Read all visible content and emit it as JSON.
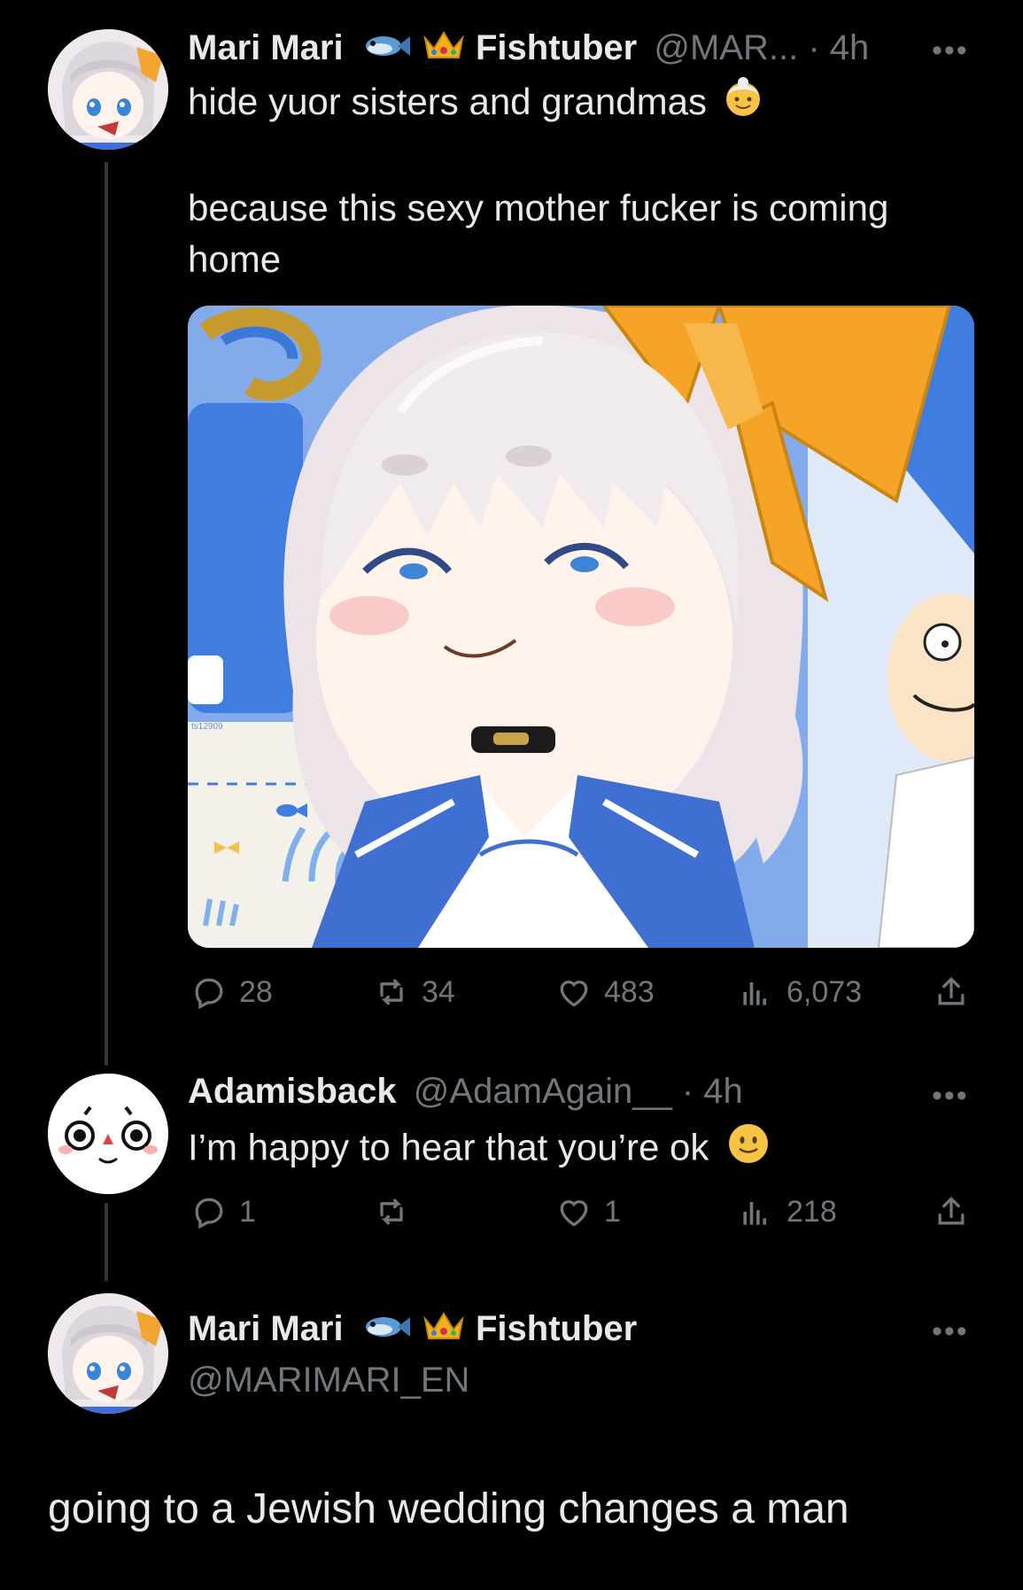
{
  "tweet1": {
    "display_name": "Mari Mari",
    "title": "Fishtuber",
    "handle_truncated": "@MAR...",
    "separator": "·",
    "time": "4h",
    "text_line1": "hide yuor sisters and grandmas",
    "text_line2": "because this sexy mother fucker is coming",
    "text_line3": "home",
    "image_fragment_text": "ts12909",
    "metrics": {
      "replies": "28",
      "reposts": "34",
      "likes": "483",
      "views": "6,073"
    }
  },
  "tweet2": {
    "display_name": "Adamisback",
    "handle": "@AdamAgain__",
    "separator": "·",
    "time": "4h",
    "text": "I’m happy to hear that you’re ok",
    "metrics": {
      "replies": "1",
      "reposts": "",
      "likes": "1",
      "views": "218"
    }
  },
  "tweet3": {
    "display_name": "Mari Mari",
    "title": "Fishtuber",
    "handle": "@MARIMARI_EN",
    "text": "going to a Jewish wedding changes a man"
  },
  "more_label": "•••",
  "icons": [
    "fish-icon",
    "crown-icon",
    "grandma-emoji-icon",
    "smile-emoji-icon",
    "reply-icon",
    "repost-icon",
    "like-icon",
    "views-icon",
    "share-icon",
    "more-icon"
  ],
  "colors": {
    "background": "#000000",
    "text": "#e7e9ea",
    "muted": "#71767b",
    "line": "#333639"
  }
}
